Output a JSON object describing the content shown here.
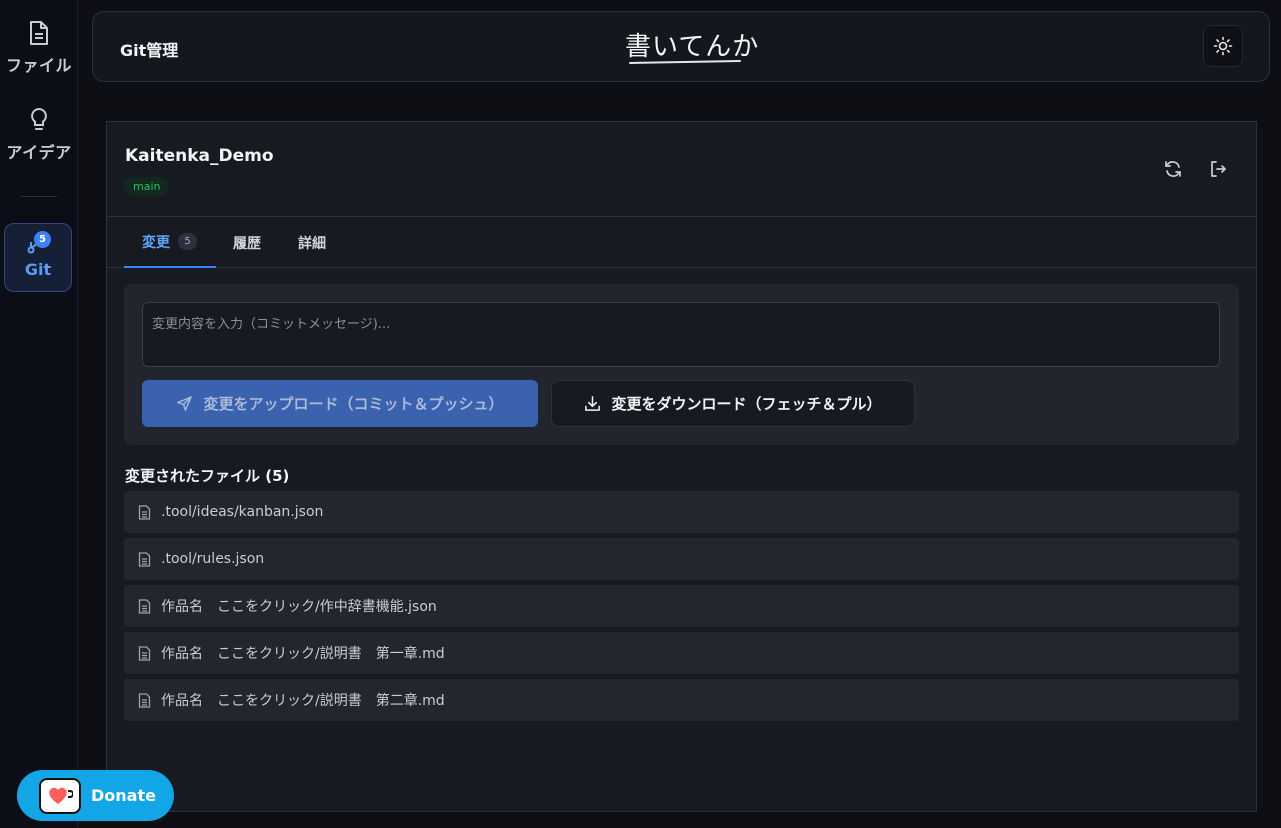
{
  "sidebar": {
    "items": [
      {
        "label": "ファイル",
        "icon": "file-icon"
      },
      {
        "label": "アイデア",
        "icon": "lightbulb-icon"
      },
      {
        "label": "Git",
        "icon": "git-icon",
        "badge": "5"
      }
    ]
  },
  "header": {
    "title": "Git管理",
    "logo": "書いてんか"
  },
  "repo": {
    "name": "Kaitenka_Demo",
    "branch": "main"
  },
  "tabs": [
    {
      "label": "変更",
      "count": "5"
    },
    {
      "label": "履歴"
    },
    {
      "label": "詳細"
    }
  ],
  "commit": {
    "placeholder": "変更内容を入力（コミットメッセージ)...",
    "upload_label": "変更をアップロード（コミット＆プッシュ）",
    "download_label": "変更をダウンロード（フェッチ＆プル）"
  },
  "files": {
    "title": "変更されたファイル (5)",
    "items": [
      ".tool/ideas/kanban.json",
      ".tool/rules.json",
      "作品名　ここをクリック/作中辞書機能.json",
      "作品名　ここをクリック/説明書　第一章.md",
      "作品名　ここをクリック/説明書　第二章.md"
    ]
  },
  "donate": {
    "label": "Donate"
  },
  "colors": {
    "accent": "#3b82f6",
    "branch": "#22c55e",
    "donate": "#13a6e6"
  }
}
